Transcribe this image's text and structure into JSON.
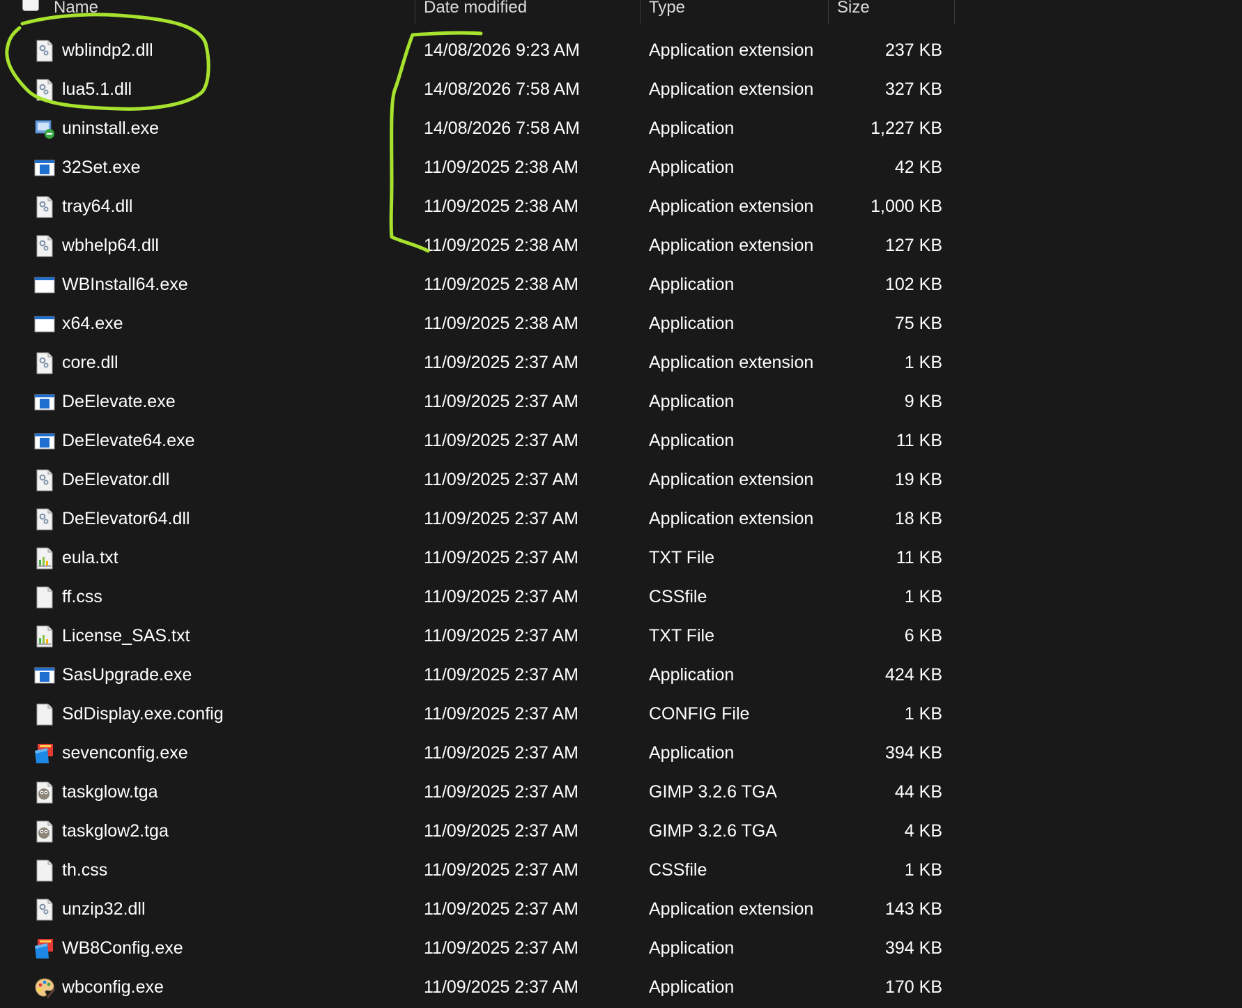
{
  "header": {
    "name": "Name",
    "date_modified": "Date modified",
    "type": "Type",
    "size": "Size"
  },
  "files": [
    {
      "name": "wblindp2.dll",
      "date": "14/08/2026 9:23 AM",
      "type": "Application extension",
      "size": "237 KB",
      "icon": "dll-gear-icon"
    },
    {
      "name": "lua5.1.dll",
      "date": "14/08/2026 7:58 AM",
      "type": "Application extension",
      "size": "327 KB",
      "icon": "dll-gear-icon"
    },
    {
      "name": "uninstall.exe",
      "date": "14/08/2026 7:58 AM",
      "type": "Application",
      "size": "1,227 KB",
      "icon": "uninstaller-icon"
    },
    {
      "name": "32Set.exe",
      "date": "11/09/2025 2:38 AM",
      "type": "Application",
      "size": "42 KB",
      "icon": "exe-window-icon"
    },
    {
      "name": "tray64.dll",
      "date": "11/09/2025 2:38 AM",
      "type": "Application extension",
      "size": "1,000 KB",
      "icon": "dll-gear-icon"
    },
    {
      "name": "wbhelp64.dll",
      "date": "11/09/2025 2:38 AM",
      "type": "Application extension",
      "size": "127 KB",
      "icon": "dll-gear-icon"
    },
    {
      "name": "WBInstall64.exe",
      "date": "11/09/2025 2:38 AM",
      "type": "Application",
      "size": "102 KB",
      "icon": "exe-window-plain-icon"
    },
    {
      "name": "x64.exe",
      "date": "11/09/2025 2:38 AM",
      "type": "Application",
      "size": "75 KB",
      "icon": "exe-window-plain-icon"
    },
    {
      "name": "core.dll",
      "date": "11/09/2025 2:37 AM",
      "type": "Application extension",
      "size": "1 KB",
      "icon": "dll-gear-icon"
    },
    {
      "name": "DeElevate.exe",
      "date": "11/09/2025 2:37 AM",
      "type": "Application",
      "size": "9 KB",
      "icon": "exe-window-icon"
    },
    {
      "name": "DeElevate64.exe",
      "date": "11/09/2025 2:37 AM",
      "type": "Application",
      "size": "11 KB",
      "icon": "exe-window-icon"
    },
    {
      "name": "DeElevator.dll",
      "date": "11/09/2025 2:37 AM",
      "type": "Application extension",
      "size": "19 KB",
      "icon": "dll-gear-icon"
    },
    {
      "name": "DeElevator64.dll",
      "date": "11/09/2025 2:37 AM",
      "type": "Application extension",
      "size": "18 KB",
      "icon": "dll-gear-icon"
    },
    {
      "name": "eula.txt",
      "date": "11/09/2025 2:37 AM",
      "type": "TXT File",
      "size": "11 KB",
      "icon": "text-chart-icon"
    },
    {
      "name": "ff.css",
      "date": "11/09/2025 2:37 AM",
      "type": "CSSfile",
      "size": "1 KB",
      "icon": "blank-file-icon"
    },
    {
      "name": "License_SAS.txt",
      "date": "11/09/2025 2:37 AM",
      "type": "TXT File",
      "size": "6 KB",
      "icon": "text-chart-icon"
    },
    {
      "name": "SasUpgrade.exe",
      "date": "11/09/2025 2:37 AM",
      "type": "Application",
      "size": "424 KB",
      "icon": "exe-window-icon"
    },
    {
      "name": "SdDisplay.exe.config",
      "date": "11/09/2025 2:37 AM",
      "type": "CONFIG File",
      "size": "1 KB",
      "icon": "blank-file-icon"
    },
    {
      "name": "sevenconfig.exe",
      "date": "11/09/2025 2:37 AM",
      "type": "Application",
      "size": "394 KB",
      "icon": "config-app-icon"
    },
    {
      "name": "taskglow.tga",
      "date": "11/09/2025 2:37 AM",
      "type": "GIMP 3.2.6 TGA",
      "size": "44 KB",
      "icon": "gimp-image-icon"
    },
    {
      "name": "taskglow2.tga",
      "date": "11/09/2025 2:37 AM",
      "type": "GIMP 3.2.6 TGA",
      "size": "4 KB",
      "icon": "gimp-image-icon"
    },
    {
      "name": "th.css",
      "date": "11/09/2025 2:37 AM",
      "type": "CSSfile",
      "size": "1 KB",
      "icon": "blank-file-icon"
    },
    {
      "name": "unzip32.dll",
      "date": "11/09/2025 2:37 AM",
      "type": "Application extension",
      "size": "143 KB",
      "icon": "dll-gear-icon"
    },
    {
      "name": "WB8Config.exe",
      "date": "11/09/2025 2:37 AM",
      "type": "Application",
      "size": "394 KB",
      "icon": "config-app-icon"
    },
    {
      "name": "wbconfig.exe",
      "date": "11/09/2025 2:37 AM",
      "type": "Application",
      "size": "170 KB",
      "icon": "palette-icon"
    }
  ],
  "colors": {
    "background": "#191919",
    "annotation": "#a6e22e",
    "exe_blue": "#1f6fd1"
  }
}
